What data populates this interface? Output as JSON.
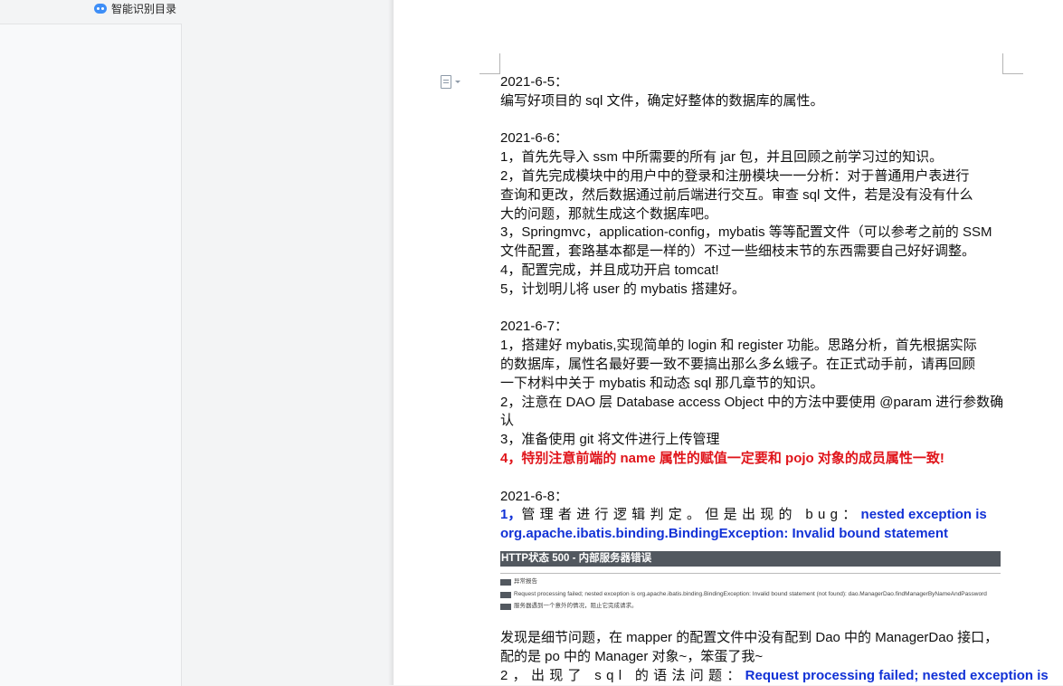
{
  "sidebar": {
    "toc_label": "智能识别目录"
  },
  "document": {
    "lines": [
      "2021-6-5：",
      "编写好项目的 sql 文件，确定好整体的数据库的属性。",
      "",
      "2021-6-6：",
      "1，首先先导入 ssm 中所需要的所有 jar 包，并且回顾之前学习过的知识。",
      "2，首先完成模块中的用户中的登录和注册模块一一分析：对于普通用户表进行",
      "查询和更改，然后数据通过前后端进行交互。审查 sql 文件，若是没有没有什么",
      "大的问题，那就生成这个数据库吧。",
      "3，Springmvc，application-config，mybatis 等等配置文件（可以参考之前的 SSM",
      "文件配置，套路基本都是一样的）不过一些细枝末节的东西需要自己好好调整。",
      "4，配置完成，并且成功开启 tomcat!",
      "5，计划明儿将 user 的 mybatis 搭建好。",
      "",
      "2021-6-7：",
      "1，搭建好 mybatis,实现简单的 login 和 register 功能。思路分析，首先根据实际",
      "的数据库，属性名最好要一致不要搞出那么多幺蛾子。在正式动手前，请再回顾",
      "一下材料中关于 mybatis 和动态 sql 那几章节的知识。",
      "2，注意在 DAO 层 Database access Object 中的方法中要使用 @param 进行参数确",
      "认",
      "3，准备使用 git 将文件进行上传管理"
    ],
    "red_line": "4，特别注意前端的 name 属性的赋值一定要和 pojo 对象的成员属性一致!",
    "date_68": "2021-6-8：",
    "line_68_prefix_blue": "1，",
    "line_68_black": "管理者进行逻辑判定。但是出现的 bug：",
    "line_68_blue_tail": "nested exception is",
    "line_68_blue_2": "org.apache.ibatis.binding.BindingException: Invalid bound statement",
    "error_image": {
      "heading": "HTTP状态 500 - 内部服务器错误",
      "row1": "异常报告",
      "row2": "Request processing failed; nested exception is org.apache.ibatis.binding.BindingException: Invalid bound statement (not found): dao.ManagerDao.findManagerByNameAndPassword",
      "row3": "服务器遇到一个意外的情况，阻止它完成请求。"
    },
    "after_lines": [
      "发现是细节问题，在 mapper 的配置文件中没有配到 Dao 中的 ManagerDao 接口，",
      "配的是 po 中的 Manager 对象~，笨蛋了我~"
    ],
    "cut_line_black": "2，出现了 sql 的语法问题：",
    "cut_line_blue": "Request processing failed; nested exception is"
  }
}
